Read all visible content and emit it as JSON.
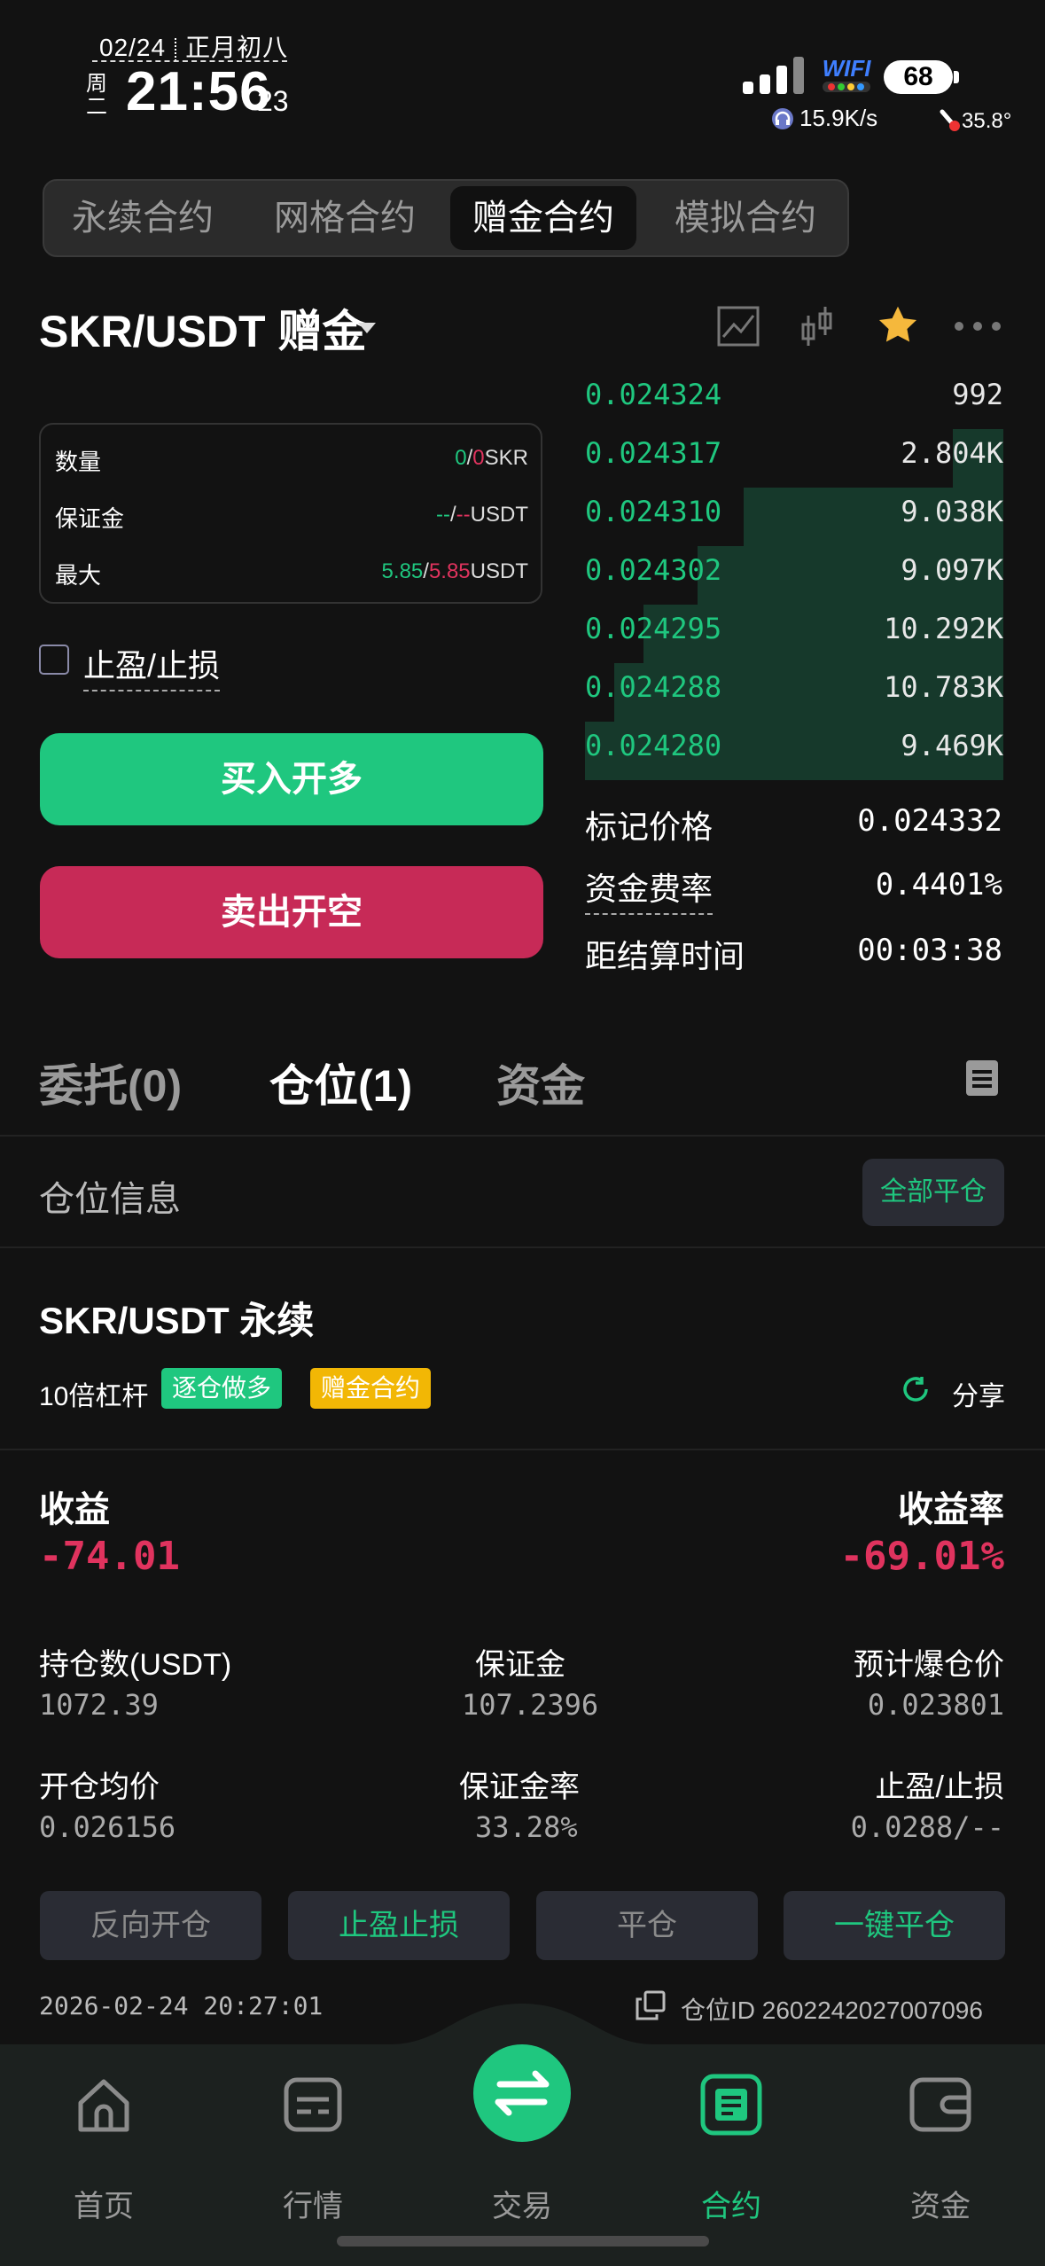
{
  "status_bar": {
    "date": "02/24",
    "lunar": "正月初八",
    "weekday": "周二",
    "time": "21:56",
    "seconds": "23",
    "wifi_label": "WIFI",
    "battery": "68",
    "net_speed": "15.9K/s",
    "temperature": "35.8°"
  },
  "top_tabs": [
    "永续合约",
    "网格合约",
    "赠金合约",
    "模拟合约"
  ],
  "active_tab_index": 2,
  "pair": "SKR/USDT 赠金",
  "header_icons": [
    "chart-line-icon",
    "candlestick-icon",
    "star-icon",
    "more-icon"
  ],
  "order_book": [
    {
      "price": "0.024324",
      "size": "992",
      "depth": 0.0
    },
    {
      "price": "0.024317",
      "size": "2.804K",
      "depth": 0.12
    },
    {
      "price": "0.024310",
      "size": "9.038K",
      "depth": 0.62
    },
    {
      "price": "0.024302",
      "size": "9.097K",
      "depth": 0.73
    },
    {
      "price": "0.024295",
      "size": "10.292K",
      "depth": 0.86
    },
    {
      "price": "0.024288",
      "size": "10.783K",
      "depth": 0.93
    },
    {
      "price": "0.024280",
      "size": "9.469K",
      "depth": 1.0
    }
  ],
  "info_box": {
    "qty_label": "数量",
    "qty_a": "0",
    "qty_sep": "/",
    "qty_b": "0",
    "qty_unit": "SKR",
    "margin_label": "保证金",
    "margin_a": "--",
    "margin_sep": "/",
    "margin_b": "--",
    "margin_unit": "USDT",
    "max_label": "最大",
    "max_a": "5.85",
    "max_sep": "/",
    "max_b": "5.85",
    "max_unit": "USDT"
  },
  "tpsl_label": "止盈/止损",
  "buy_label": "买入开多",
  "sell_label": "卖出开空",
  "market": [
    {
      "label": "标记价格",
      "value": "0.024332"
    },
    {
      "label": "资金费率",
      "value": "0.4401%"
    },
    {
      "label": "距结算时间",
      "value": "00:03:38"
    }
  ],
  "section_tabs": [
    "委托(0)",
    "仓位(1)",
    "资金"
  ],
  "active_section_index": 1,
  "position_info_label": "仓位信息",
  "close_all_label": "全部平仓",
  "position": {
    "title": "SKR/USDT 永续",
    "leverage": "10倍杠杆",
    "badge_mode": "逐仓做多",
    "badge_bonus": "赠金合约",
    "share_label": "分享",
    "pnl_label": "收益",
    "pnl_value": "-74.01",
    "roe_label": "收益率",
    "roe_value": "-69.01%",
    "size_label": "持仓数(USDT)",
    "size_value": "1072.39",
    "margin_label": "保证金",
    "margin_value": "107.2396",
    "liq_label": "预计爆仓价",
    "liq_value": "0.023801",
    "entry_label": "开仓均价",
    "entry_value": "0.026156",
    "margin_rate_label": "保证金率",
    "margin_rate_value": "33.28%",
    "tpsl_label": "止盈/止损",
    "tpsl_value": "0.0288/--",
    "actions": [
      "反向开仓",
      "止盈止损",
      "平仓",
      "一键平仓"
    ],
    "timestamp": "2026-02-24 20:27:01",
    "position_id": "仓位ID 2602242027007096"
  },
  "nav": [
    "首页",
    "行情",
    "交易",
    "合约",
    "资金"
  ],
  "active_nav_index": 3,
  "colors": {
    "green": "#1fc77f",
    "red": "#c72a57",
    "bg": "#121212",
    "bonus": "#f2b705"
  }
}
